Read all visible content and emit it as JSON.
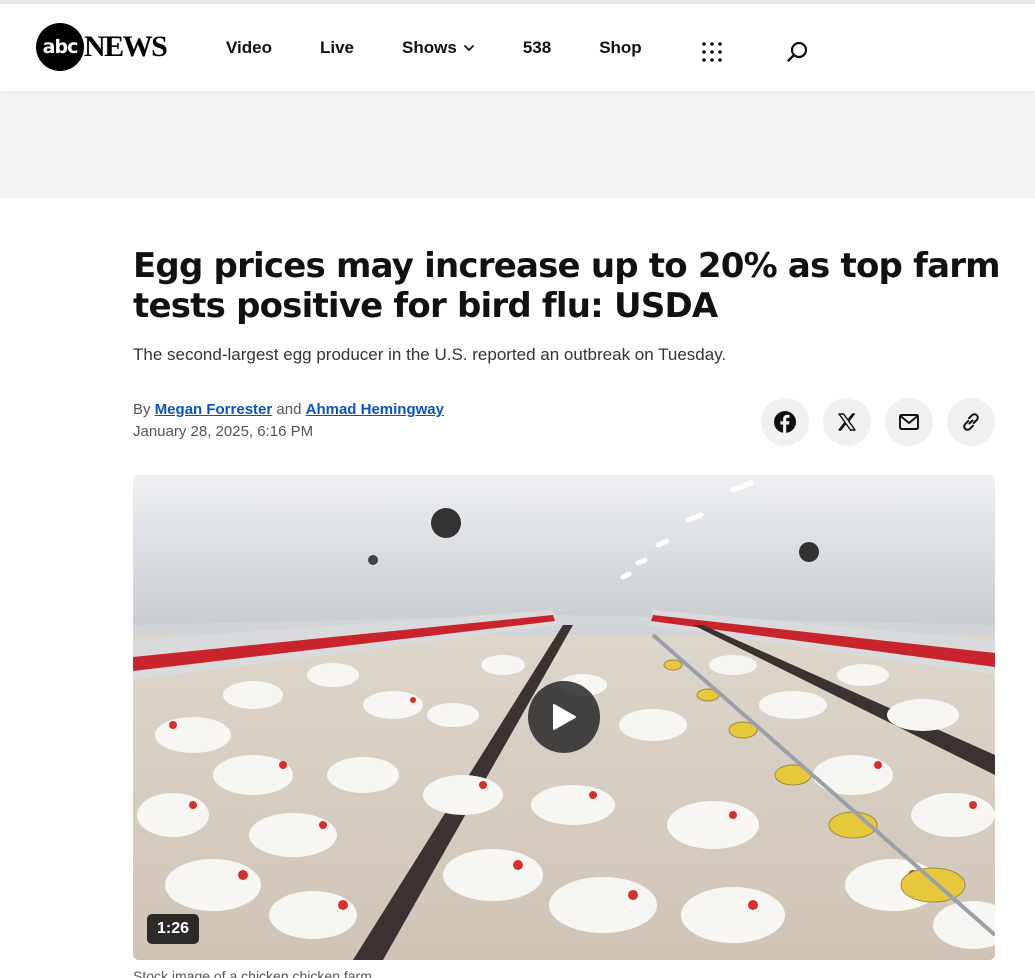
{
  "header": {
    "logo_mark": "abc",
    "logo_text": "NEWS",
    "nav": [
      {
        "label": "Video"
      },
      {
        "label": "Live"
      },
      {
        "label": "Shows"
      },
      {
        "label": "538"
      },
      {
        "label": "Shop"
      }
    ],
    "icons": [
      "grid-menu-icon",
      "search-icon",
      "chevron-down-icon"
    ]
  },
  "article": {
    "headline": "Egg prices may increase up to 20% as top farm tests positive for bird flu: USDA",
    "dek": "The second-largest egg producer in the U.S. reported an outbreak on Tuesday.",
    "byline_prefix": "By",
    "author1": "Megan Forrester",
    "byline_and": "and",
    "author2": "Ahmad Hemingway",
    "date": "January 28, 2025, 6:16 PM",
    "share_icons": [
      "facebook-icon",
      "x-icon",
      "email-icon",
      "link-icon"
    ],
    "video": {
      "duration": "1:26",
      "caption": "Stock image of a chicken chicken farm"
    }
  },
  "colors": {
    "link": "#0a52c7",
    "ad_band": "#f4f4f4",
    "share_button": "#f1f1f1"
  }
}
